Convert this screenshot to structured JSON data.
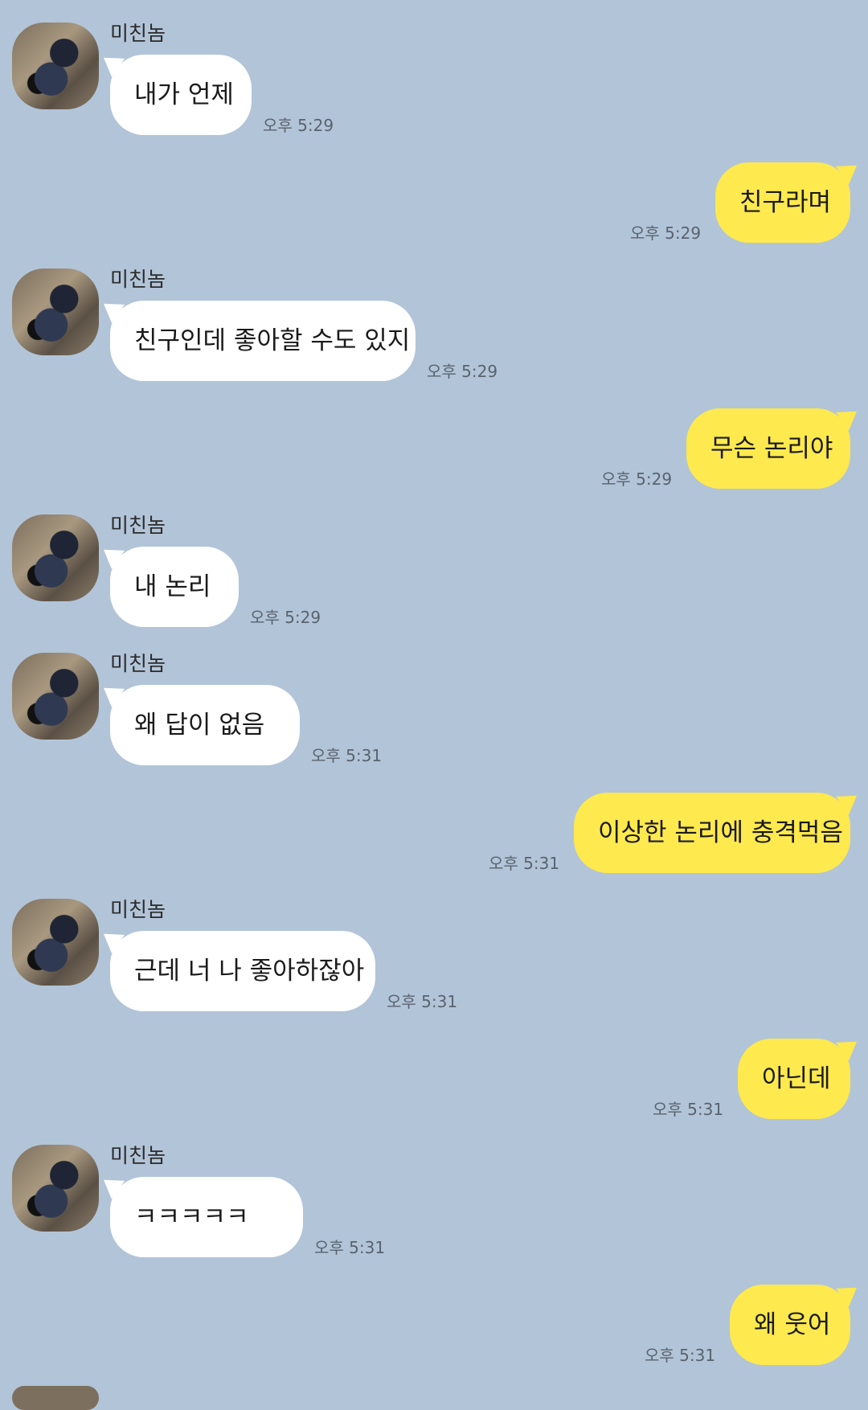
{
  "sender_name": "미친놈",
  "messages": [
    {
      "dir": "in",
      "text": "내가 언제",
      "time": "오후 5:29"
    },
    {
      "dir": "out",
      "text": "친구라며",
      "time": "오후 5:29"
    },
    {
      "dir": "in",
      "text": "친구인데 좋아할 수도 있지",
      "time": "오후 5:29"
    },
    {
      "dir": "out",
      "text": "무슨 논리야",
      "time": "오후 5:29"
    },
    {
      "dir": "in",
      "text": "내 논리",
      "time": "오후 5:29"
    },
    {
      "dir": "in",
      "text": "왜 답이 없음",
      "time": "오후 5:31"
    },
    {
      "dir": "out",
      "text": "이상한 논리에 충격먹음",
      "time": "오후 5:31"
    },
    {
      "dir": "in",
      "text": "근데 너 나 좋아하잖아",
      "time": "오후 5:31"
    },
    {
      "dir": "out",
      "text": "아닌데",
      "time": "오후 5:31"
    },
    {
      "dir": "in",
      "text": "ㅋㅋㅋㅋㅋ",
      "time": "오후 5:31"
    },
    {
      "dir": "out",
      "text": "왜 웃어",
      "time": "오후 5:31"
    }
  ],
  "colors": {
    "background": "#b2c4d8",
    "incoming_bubble": "#ffffff",
    "outgoing_bubble": "#fee94e"
  }
}
